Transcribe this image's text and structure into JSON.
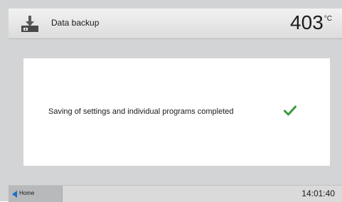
{
  "header": {
    "title": "Data backup",
    "icon": "data-backup-icon",
    "temperature_value": "403",
    "temperature_unit": "°C"
  },
  "dialog": {
    "message": "Saving of settings and individual programs completed",
    "status_icon": "checkmark-icon",
    "status_color": "#3a9a3a"
  },
  "footer": {
    "home_label": "Home",
    "home_icon": "back-arrow-icon",
    "clock": "14:01:40"
  },
  "colors": {
    "accent_blue": "#1f6fc2",
    "background": "#d3d4d5"
  }
}
